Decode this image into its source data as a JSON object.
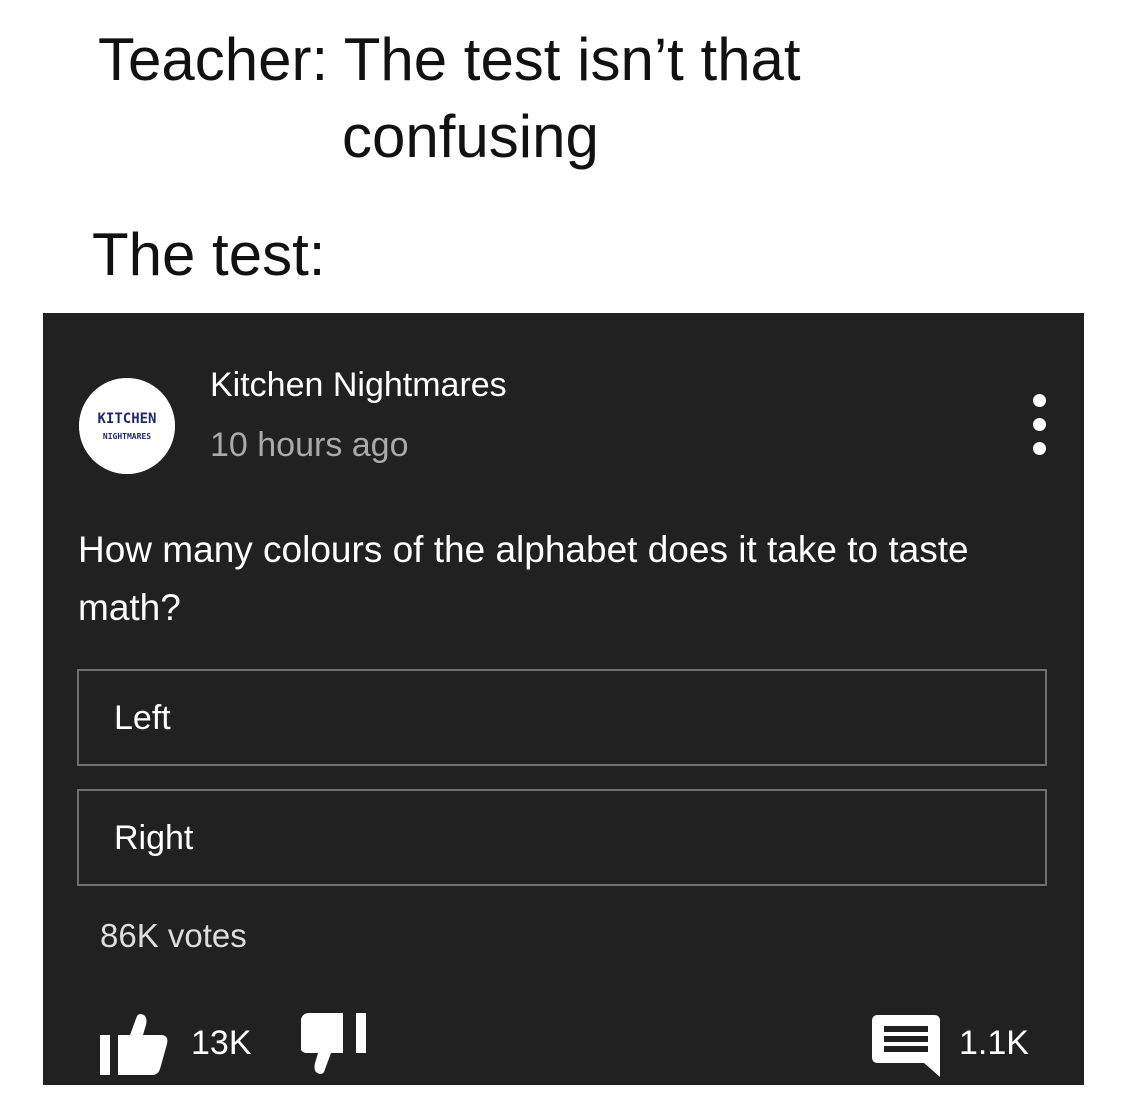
{
  "meme": {
    "caption_line_1": "Teacher: The test isn’t that",
    "caption_line_2": "confusing",
    "caption_line_3": "The test:"
  },
  "post": {
    "avatar": {
      "logo_line_1": "KITCHEN",
      "logo_line_2": "NIGHTMARES"
    },
    "channel_name": "Kitchen Nightmares",
    "time": "10 hours ago",
    "question": "How many colours of the alphabet does it take to taste math?",
    "options": [
      {
        "label": "Left"
      },
      {
        "label": "Right"
      }
    ],
    "votes": "86K votes",
    "likes": "13K",
    "comments": "1.1K",
    "icons": {
      "more": "more-vert-icon",
      "like": "thumbs-up-icon",
      "dislike": "thumbs-down-icon",
      "comment": "comment-icon"
    }
  },
  "colors": {
    "page_background": "#ffffff",
    "caption_text": "#111111",
    "card_background": "#212121",
    "primary_text": "#ffffff",
    "secondary_text": "#aaaaaa",
    "option_border": "#6f6f6f",
    "logo_text": "#1f2c6b"
  }
}
